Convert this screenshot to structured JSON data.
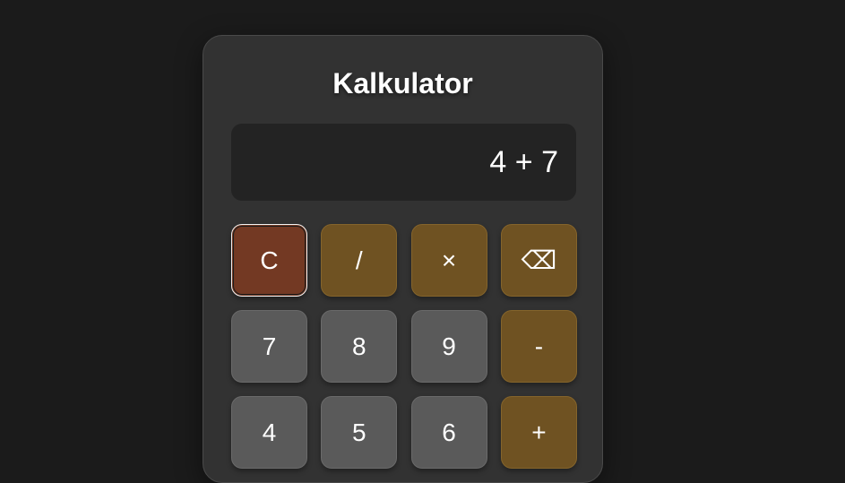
{
  "app": {
    "title": "Kalkulator"
  },
  "display": {
    "value": "4 + 7"
  },
  "keys": {
    "clear": "C",
    "divide": "/",
    "multiply": "×",
    "backspace": "⌫",
    "seven": "7",
    "eight": "8",
    "nine": "9",
    "minus": "-",
    "four": "4",
    "five": "5",
    "six": "6",
    "plus": "+"
  },
  "colors": {
    "background": "#1b1b1b",
    "card": "#323232",
    "display": "#232323",
    "number_key": "#5a5a5a",
    "operator_key": "#6f5222",
    "clear_key": "#733923",
    "text": "#ffffff"
  },
  "icons": {
    "backspace": "backspace-icon"
  }
}
